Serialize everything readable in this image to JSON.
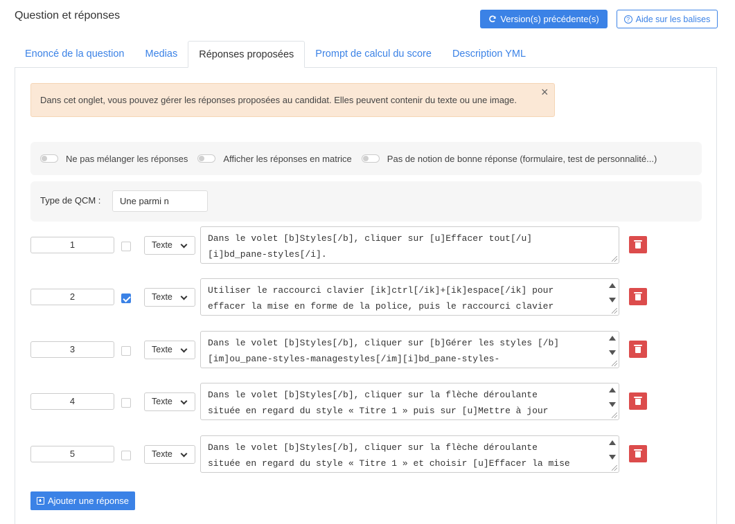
{
  "page": {
    "title": "Question et réponses"
  },
  "header": {
    "versions_button": "Version(s) précédente(s)",
    "versions_icon": "refresh-icon",
    "help_button": "Aide sur les balises",
    "help_icon": "question-circle-icon"
  },
  "tabs": [
    {
      "label": "Enoncé de la question",
      "active": false
    },
    {
      "label": "Medias",
      "active": false
    },
    {
      "label": "Réponses proposées",
      "active": true
    },
    {
      "label": "Prompt de calcul du score",
      "active": false
    },
    {
      "label": "Description YML",
      "active": false
    }
  ],
  "alert": {
    "text": "Dans cet onglet, vous pouvez gérer les réponses proposées au candidat. Elles peuvent contenir du texte ou une image.",
    "close": "×"
  },
  "options": [
    {
      "label": "Ne pas mélanger les réponses",
      "checked": false
    },
    {
      "label": "Afficher les réponses en matrice",
      "checked": false
    },
    {
      "label": "Pas de notion de bonne réponse (formulaire, test de personnalité...)",
      "checked": false
    }
  ],
  "qcm": {
    "label": "Type de QCM :",
    "value": "Une parmi n"
  },
  "answers": [
    {
      "order": "1",
      "correct": false,
      "type": "Texte",
      "text": "Dans le volet [b]Styles[/b], cliquer sur [u]Effacer tout[/u]\n[i]bd_pane-styles[/i].",
      "scrollable": false
    },
    {
      "order": "2",
      "correct": true,
      "type": "Texte",
      "text": "Utiliser le raccourci clavier [ik]ctrl[/ik]+[ik]espace[/ik] pour\neffacer la mise en forme de la police, puis le raccourci clavier",
      "scrollable": true
    },
    {
      "order": "3",
      "correct": false,
      "type": "Texte",
      "text": "Dans le volet [b]Styles[/b], cliquer sur [b]Gérer les styles [/b]\n[im]ou_pane-styles-managestyles[/im][i]bd_pane-styles-",
      "scrollable": true
    },
    {
      "order": "4",
      "correct": false,
      "type": "Texte",
      "text": "Dans le volet [b]Styles[/b], cliquer sur la flèche déroulante\nsituée en regard du style « Titre 1 » puis sur [u]Mettre à jour",
      "scrollable": true
    },
    {
      "order": "5",
      "correct": false,
      "type": "Texte",
      "text": "Dans le volet [b]Styles[/b], cliquer sur la flèche déroulante\nsituée en regard du style « Titre 1 » et choisir [u]Effacer la mise",
      "scrollable": true
    }
  ],
  "add_button": "Ajouter une réponse",
  "colors": {
    "primary": "#3b82e6",
    "danger": "#dc4c4c",
    "alert_bg": "#fbe8d6"
  }
}
